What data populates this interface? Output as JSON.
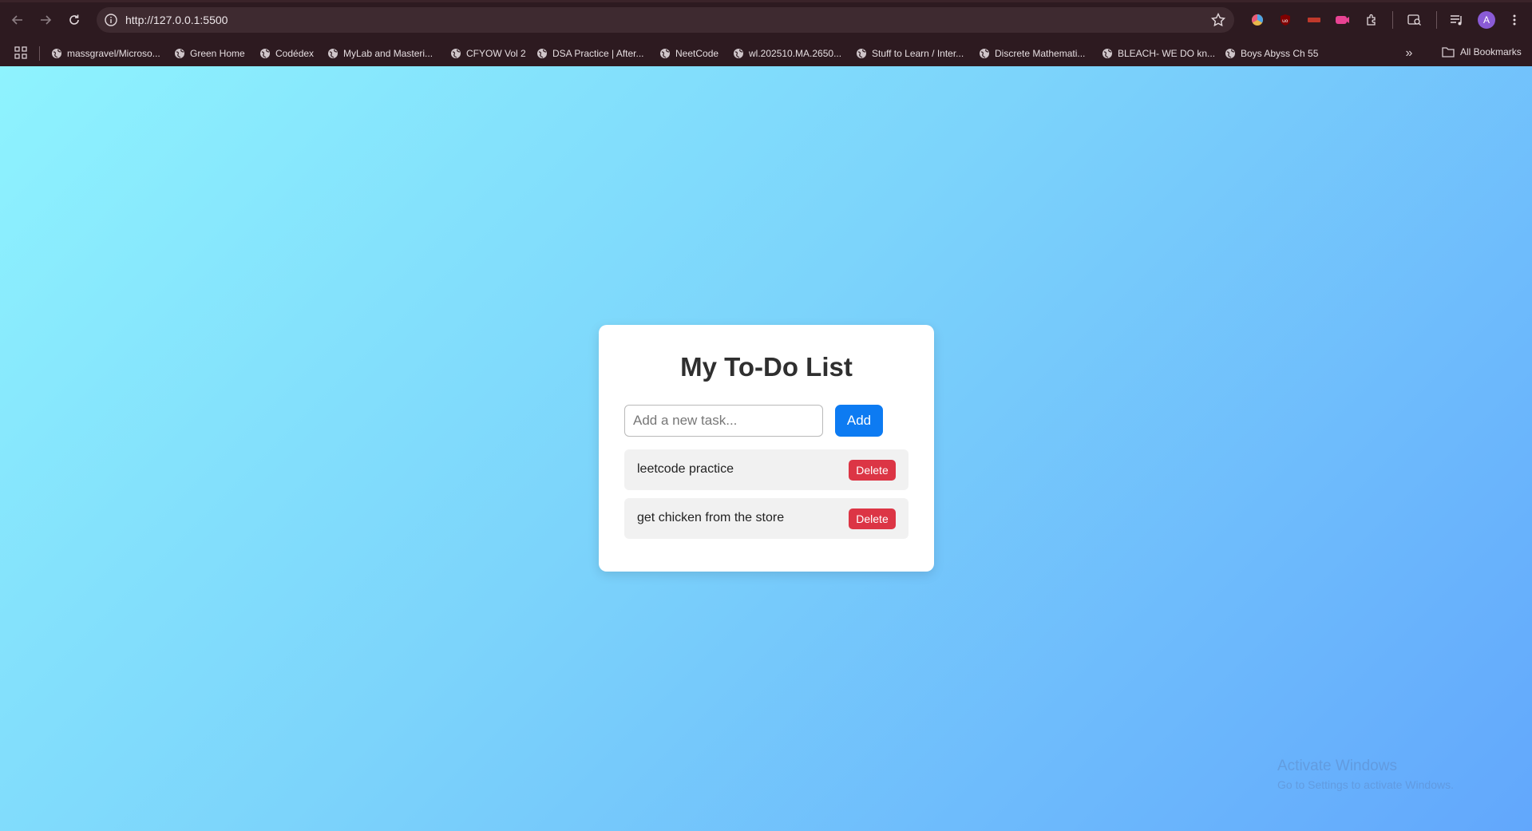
{
  "browser": {
    "url": "http://127.0.0.1:5500",
    "profile_initial": "A",
    "bookmarks": [
      {
        "label": "massgravel/Microso..."
      },
      {
        "label": "Green Home"
      },
      {
        "label": "Codédex"
      },
      {
        "label": "MyLab and Masteri..."
      },
      {
        "label": "CFYOW Vol 2"
      },
      {
        "label": "DSA Practice | After..."
      },
      {
        "label": "NeetCode"
      },
      {
        "label": "wl.202510.MA.2650..."
      },
      {
        "label": "Stuff to Learn / Inter..."
      },
      {
        "label": "Discrete Mathemati..."
      },
      {
        "label": "BLEACH- WE DO kn..."
      },
      {
        "label": "Boys Abyss Ch 55"
      }
    ],
    "all_bookmarks_label": "All Bookmarks",
    "more_label": "»"
  },
  "app": {
    "title": "My To-Do List",
    "input_placeholder": "Add a new task...",
    "input_value": "",
    "add_label": "Add",
    "tasks": [
      {
        "text": "leetcode practice",
        "delete_label": "Delete"
      },
      {
        "text": "get chicken from the store",
        "delete_label": "Delete"
      }
    ]
  },
  "os": {
    "watermark_line1": "Activate Windows",
    "watermark_line2": "Go to Settings to activate Windows."
  },
  "colors": {
    "accent": "#0d7bf2",
    "danger": "#dc3545",
    "gradient_start": "#8ef3fe",
    "gradient_end": "#62a7fc"
  }
}
